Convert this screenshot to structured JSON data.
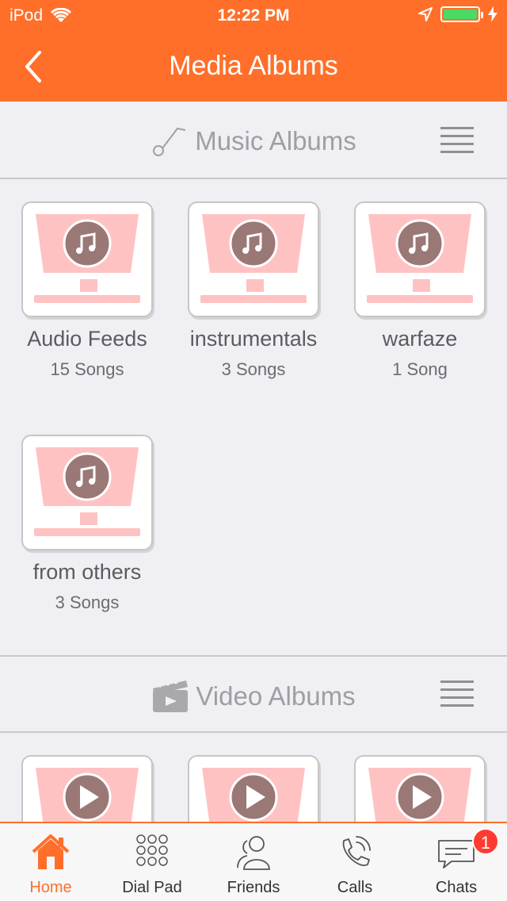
{
  "status_bar": {
    "carrier": "iPod",
    "time": "12:22 PM"
  },
  "header": {
    "title": "Media Albums",
    "accent_color": "#ff6f2a"
  },
  "music_section": {
    "title": "Music Albums",
    "albums": [
      {
        "name": "Audio Feeds",
        "count": "15 Songs"
      },
      {
        "name": "instrumentals",
        "count": "3 Songs"
      },
      {
        "name": "warfaze",
        "count": "1 Song"
      },
      {
        "name": "from others",
        "count": "3 Songs"
      }
    ]
  },
  "video_section": {
    "title": "Video Albums"
  },
  "tab_bar": {
    "tabs": [
      {
        "label": "Home",
        "icon": "home-icon"
      },
      {
        "label": "Dial Pad",
        "icon": "dialpad-icon"
      },
      {
        "label": "Friends",
        "icon": "friends-icon"
      },
      {
        "label": "Calls",
        "icon": "phone-icon"
      },
      {
        "label": "Chats",
        "icon": "chat-icon"
      }
    ],
    "chats_badge": "1"
  }
}
